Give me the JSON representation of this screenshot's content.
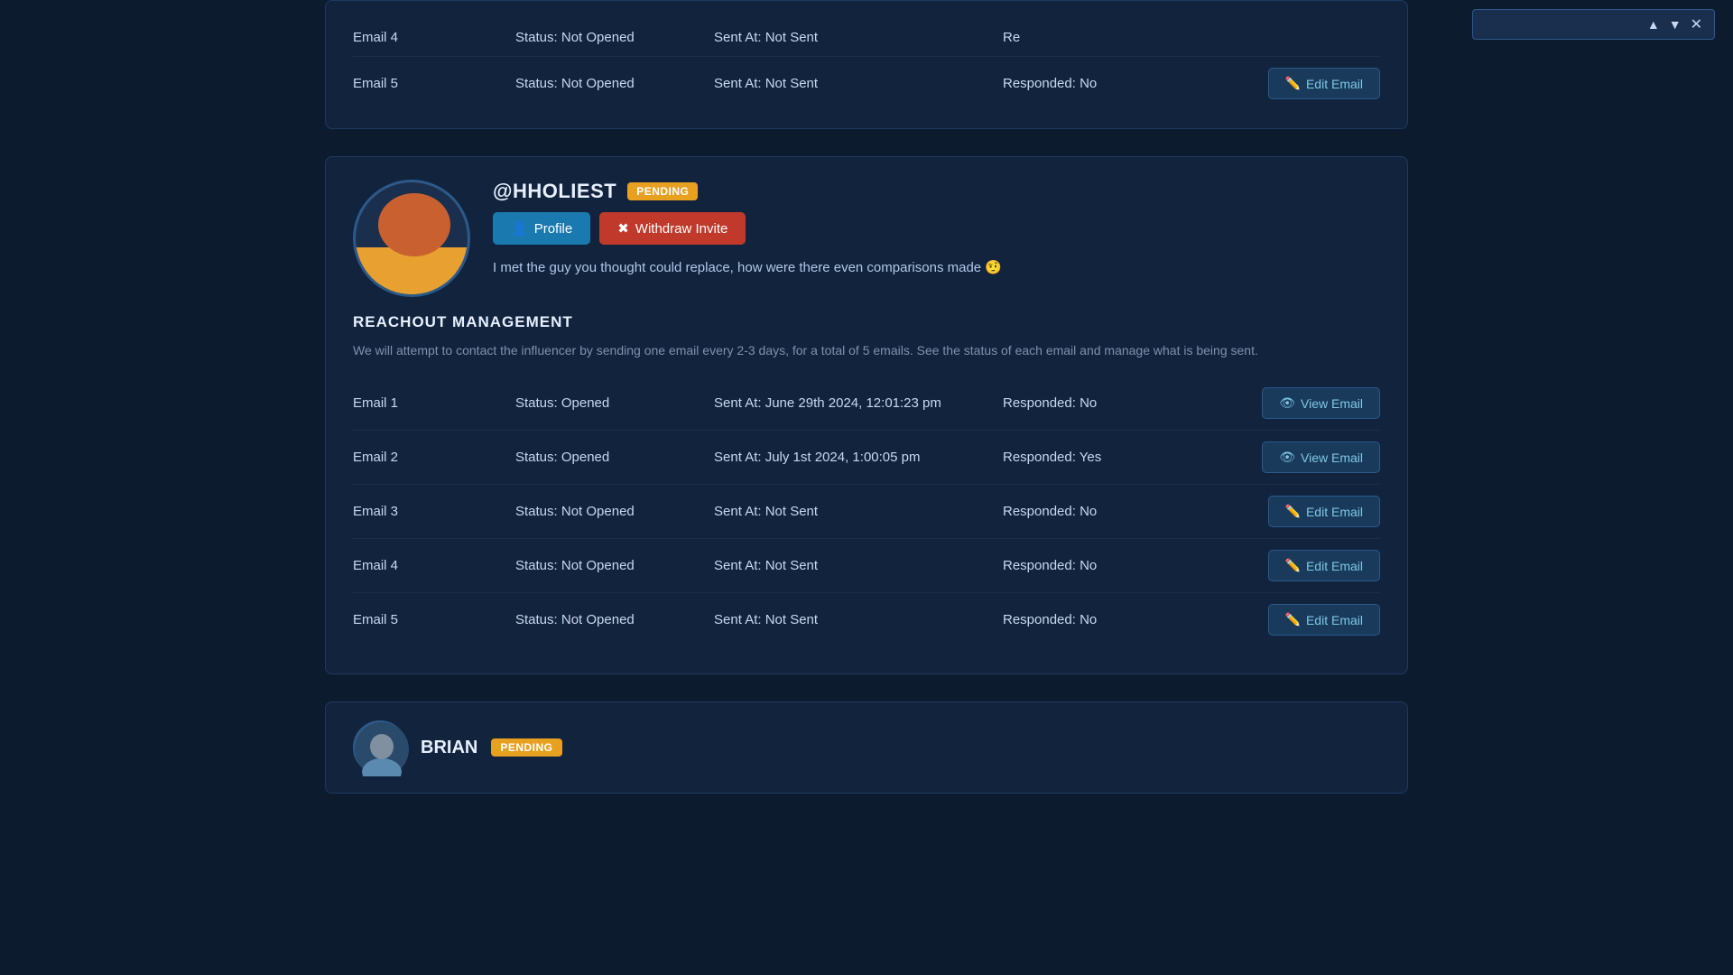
{
  "find_bar": {
    "placeholder": "",
    "value": "",
    "prev_label": "▲",
    "next_label": "▼",
    "close_label": "✕"
  },
  "top_card": {
    "emails": [
      {
        "name": "Email 4",
        "status": "Status: Not Opened",
        "sent_at": "Sent At: Not Sent",
        "responded": "Re",
        "action": "edit"
      },
      {
        "name": "Email 5",
        "status": "Status: Not Opened",
        "sent_at": "Sent At: Not Sent",
        "responded": "Responded: No",
        "action": "edit",
        "action_label": "Edit Email"
      }
    ]
  },
  "influencer": {
    "handle": "@HHOLIEST",
    "badge": "PENDING",
    "profile_btn": "Profile",
    "withdraw_btn": "Withdraw Invite",
    "quote": "I met the guy you thought could replace, how were there even comparisons made 🤨",
    "reachout_title": "REACHOUT MANAGEMENT",
    "reachout_desc": "We will attempt to contact the influencer by sending one email every 2-3 days, for a total of 5 emails. See the status of each email and manage what is being sent.",
    "emails": [
      {
        "name": "Email 1",
        "status": "Status: Opened",
        "sent_at": "Sent At: June 29th 2024, 12:01:23 pm",
        "responded": "Responded: No",
        "action": "view",
        "action_label": "View Email"
      },
      {
        "name": "Email 2",
        "status": "Status: Opened",
        "sent_at": "Sent At: July 1st 2024, 1:00:05 pm",
        "responded": "Responded: Yes",
        "action": "view",
        "action_label": "View Email"
      },
      {
        "name": "Email 3",
        "status": "Status: Not Opened",
        "sent_at": "Sent At: Not Sent",
        "responded": "Responded: No",
        "action": "edit",
        "action_label": "Edit Email"
      },
      {
        "name": "Email 4",
        "status": "Status: Not Opened",
        "sent_at": "Sent At: Not Sent",
        "responded": "Responded: No",
        "action": "edit",
        "action_label": "Edit Email"
      },
      {
        "name": "Email 5",
        "status": "Status: Not Opened",
        "sent_at": "Sent At: Not Sent",
        "responded": "Responded: No",
        "action": "edit",
        "action_label": "Edit Email"
      }
    ]
  },
  "bottom_card": {
    "handle": "BRIAN",
    "badge": "PENDING"
  }
}
